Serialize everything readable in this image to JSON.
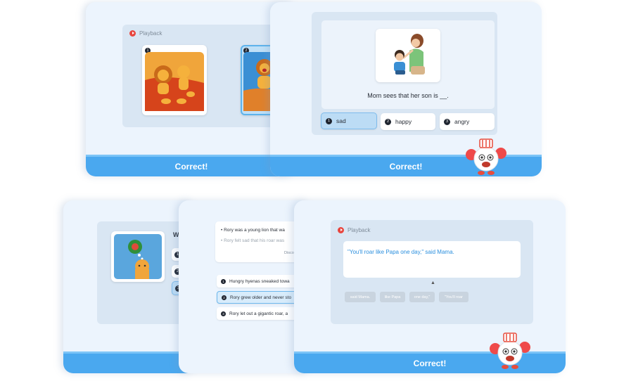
{
  "colors": {
    "footer": "#4aa8ef",
    "panel": "#d9e6f3",
    "card": "#ecf4fd",
    "accent_text": "#2b8fde",
    "play": "#e8463f"
  },
  "top_left": {
    "playback_label": "Playback",
    "image_numbers": [
      "1",
      "2"
    ],
    "footer_label": "Correct!"
  },
  "top_right": {
    "sentence": "Mom sees that her son is __.",
    "options": [
      {
        "number": "1",
        "label": "sad",
        "selected": true
      },
      {
        "number": "2",
        "label": "happy",
        "selected": false
      },
      {
        "number": "3",
        "label": "angry",
        "selected": false
      }
    ],
    "footer_label": "Correct!"
  },
  "bottom_left": {
    "question_fragment": "W",
    "option_numbers": [
      "1",
      "2",
      "3"
    ]
  },
  "bottom_middle": {
    "story_lines": [
      "Rory was a young lion that wa",
      "Rory felt sad that his roar was"
    ],
    "story_fragment": "Disco",
    "options": [
      {
        "number": "1",
        "label": "Hungry hyenas sneaked towa",
        "selected": false
      },
      {
        "number": "2",
        "label": "Rory grew older and never sto",
        "selected": true
      },
      {
        "number": "3",
        "label": "Rory let out a gigantic roar, a",
        "selected": false
      }
    ]
  },
  "bottom_right": {
    "playback_label": "Playback",
    "quote": "\"You'll roar like Papa one day,\" said Mama.",
    "word_chips": [
      "said Mama.",
      "like Papa",
      "one day,\"",
      "\"You'll roar"
    ],
    "footer_label": "Correct!"
  },
  "icons": [
    "play-icon",
    "mascot-icon",
    "lion-icon",
    "mother-son-icon",
    "cursor-icon"
  ]
}
